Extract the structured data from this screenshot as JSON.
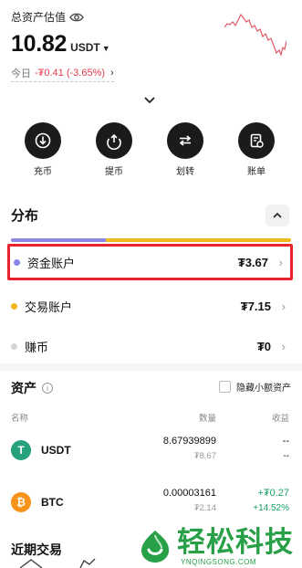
{
  "header": {
    "title": "总资产估值",
    "balance": "10.82",
    "unit": "USDT",
    "today_label": "今日",
    "today_change": "-₮0.41 (-3.65%)"
  },
  "actions": [
    {
      "label": "充币",
      "icon": "deposit-icon"
    },
    {
      "label": "提币",
      "icon": "withdraw-icon"
    },
    {
      "label": "划转",
      "icon": "transfer-icon"
    },
    {
      "label": "账单",
      "icon": "bill-icon"
    }
  ],
  "distribution": {
    "title": "分布",
    "bar": [
      {
        "name": "资金账户",
        "fraction": 0.34,
        "color": "#8b86e6"
      },
      {
        "name": "交易账户",
        "fraction": 0.66,
        "color": "#f2b61f"
      }
    ],
    "accounts": [
      {
        "name": "资金账户",
        "value": "₮3.67",
        "color": "#8b86e6"
      },
      {
        "name": "交易账户",
        "value": "₮7.15",
        "color": "#f2b61f"
      },
      {
        "name": "赚币",
        "value": "₮0",
        "color": "#d6d6d6"
      }
    ]
  },
  "assets": {
    "title": "资产",
    "hide_small_label": "隐藏小额资产",
    "columns": {
      "name": "名称",
      "amount": "数量",
      "pnl": "收益"
    },
    "rows": [
      {
        "symbol": "USDT",
        "amount": "8.67939899",
        "amount_cny": "₮8.67",
        "pnl": "--",
        "pnl_pct": "--",
        "coin_color": "#26a17b",
        "coin_glyph": "T"
      },
      {
        "symbol": "BTC",
        "amount": "0.00003161",
        "amount_cny": "₮2.14",
        "pnl": "+₮0.27",
        "pnl_pct": "+14.52%",
        "coin_color": "#f7931a",
        "coin_glyph": "₿"
      }
    ]
  },
  "recent_title": "近期交易",
  "watermark": {
    "text": "轻松科技",
    "sub": "YNQINGSONG.COM",
    "color": "#27a048"
  }
}
